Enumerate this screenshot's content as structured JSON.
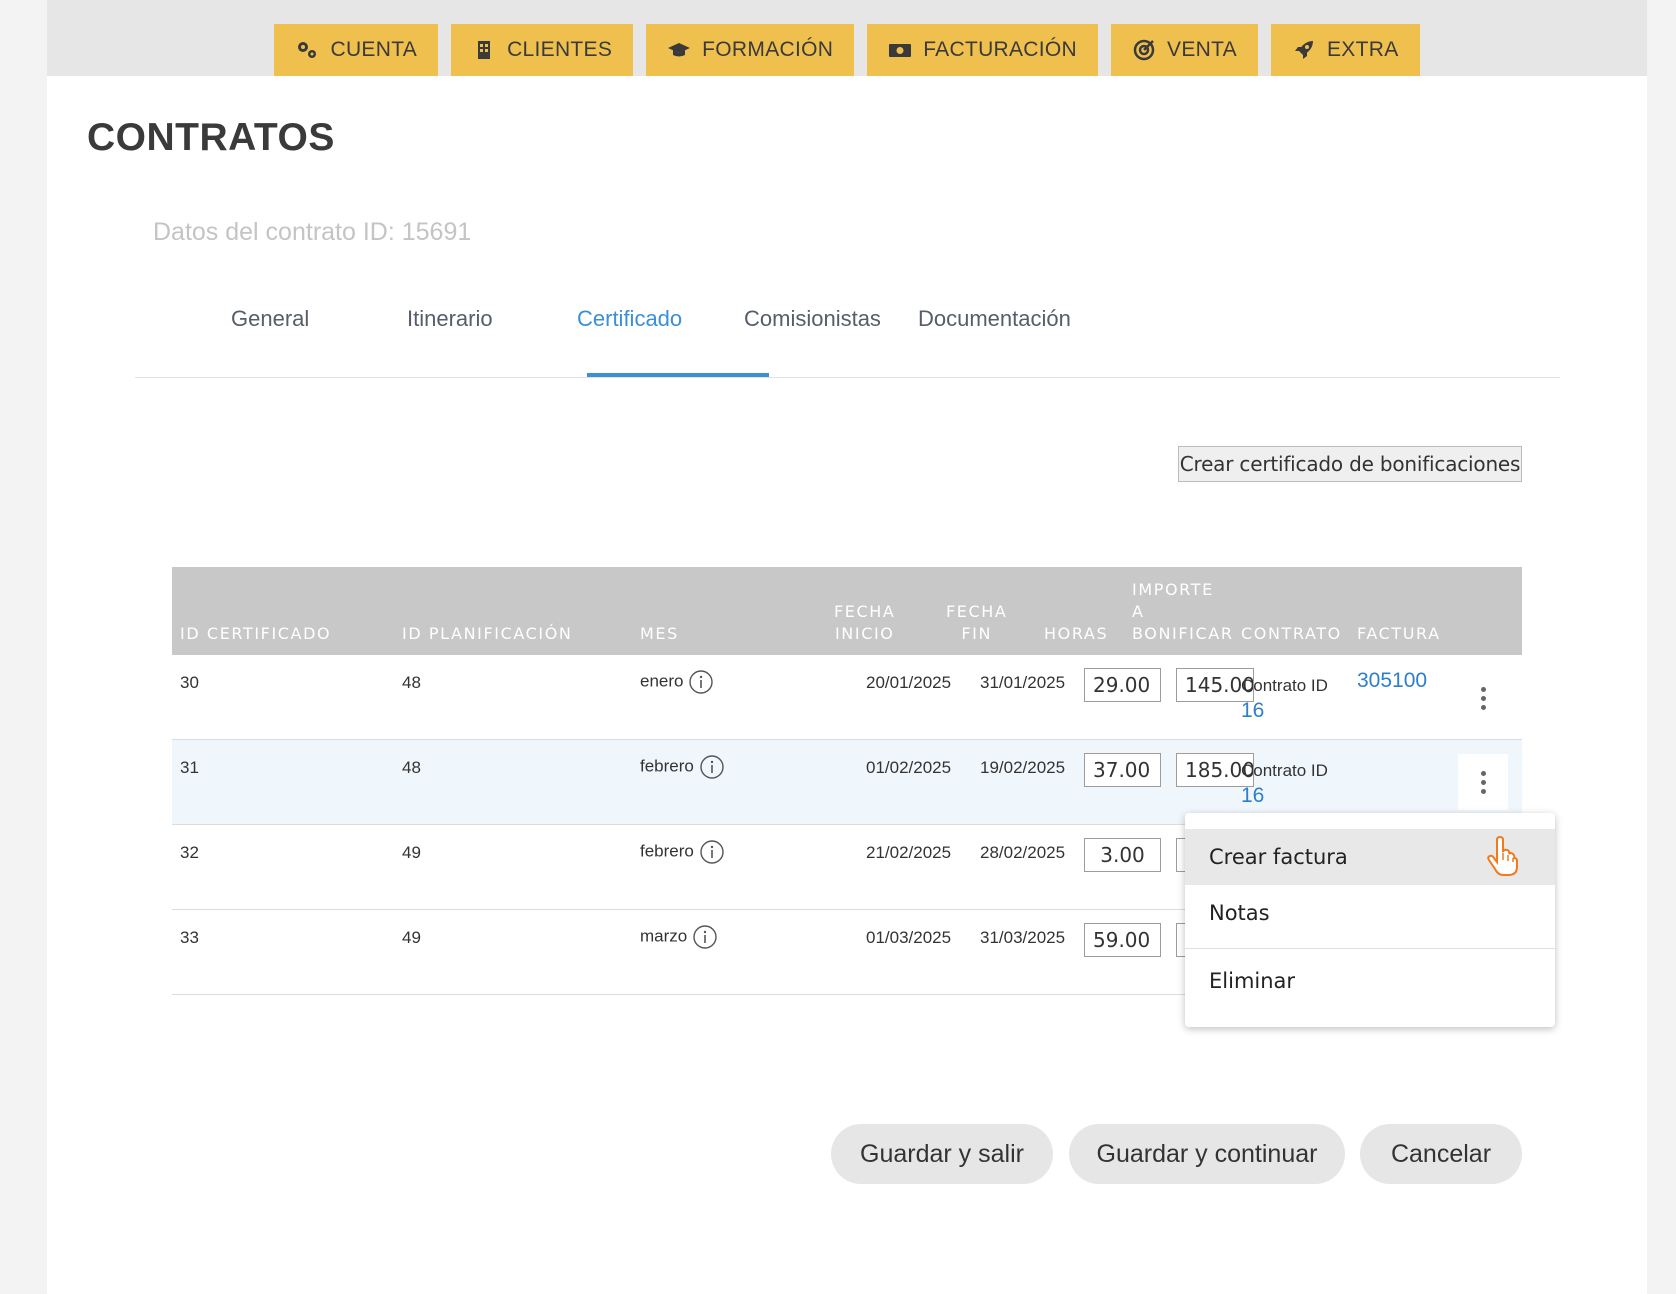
{
  "nav": {
    "items": [
      {
        "label": "CUENTA",
        "icon": "gears-icon"
      },
      {
        "label": "CLIENTES",
        "icon": "building-icon"
      },
      {
        "label": "FORMACIÓN",
        "icon": "graduation-cap-icon"
      },
      {
        "label": "FACTURACIÓN",
        "icon": "money-bill-icon"
      },
      {
        "label": "VENTA",
        "icon": "target-icon"
      },
      {
        "label": "EXTRA",
        "icon": "rocket-icon"
      }
    ],
    "accent_color": "#f0c04f"
  },
  "page": {
    "title": "CONTRATOS",
    "subtitle": "Datos del contrato ID: 15691"
  },
  "tabs": {
    "items": [
      "General",
      "Itinerario",
      "Certificado",
      "Comisionistas",
      "Documentación"
    ],
    "active": "Certificado",
    "active_color": "#3a8fd8"
  },
  "actions": {
    "create_certificate": "Crear certificado de bonificaciones"
  },
  "table": {
    "headers": {
      "id_certificado": "ID CERTIFICADO",
      "id_planificacion": "ID PLANIFICACIÓN",
      "mes": "MES",
      "fecha_inicio_1": "FECHA",
      "fecha_inicio_2": "INICIO",
      "fecha_fin_1": "FECHA",
      "fecha_fin_2": "FIN",
      "horas": "HORAS",
      "importe_1": "IMPORTE",
      "importe_2": "A",
      "importe_3": "BONIFICAR",
      "contrato": "CONTRATO",
      "factura": "FACTURA"
    },
    "rows": [
      {
        "id": "30",
        "planificacion": "48",
        "mes": "enero",
        "inicio": "20/01/2025",
        "fin": "31/01/2025",
        "horas": "29.00",
        "importe": "145.00",
        "contrato_label": "Contrato ID",
        "contrato_id": "16",
        "factura": "305100"
      },
      {
        "id": "31",
        "planificacion": "48",
        "mes": "febrero",
        "inicio": "01/02/2025",
        "fin": "19/02/2025",
        "horas": "37.00",
        "importe": "185.00",
        "contrato_label": "Contrato ID",
        "contrato_id": "16",
        "factura": ""
      },
      {
        "id": "32",
        "planificacion": "49",
        "mes": "febrero",
        "inicio": "21/02/2025",
        "fin": "28/02/2025",
        "horas": "3.00",
        "importe": "",
        "contrato_label": "",
        "contrato_id": "",
        "factura": ""
      },
      {
        "id": "33",
        "planificacion": "49",
        "mes": "marzo",
        "inicio": "01/03/2025",
        "fin": "31/03/2025",
        "horas": "59.00",
        "importe": "",
        "contrato_label": "",
        "contrato_id": "",
        "factura": ""
      }
    ]
  },
  "context_menu": {
    "items": [
      "Crear factura",
      "Notas",
      "Eliminar"
    ],
    "hovered": "Crear factura"
  },
  "footer": {
    "save_exit": "Guardar y salir",
    "save_continue": "Guardar y continuar",
    "cancel": "Cancelar"
  }
}
